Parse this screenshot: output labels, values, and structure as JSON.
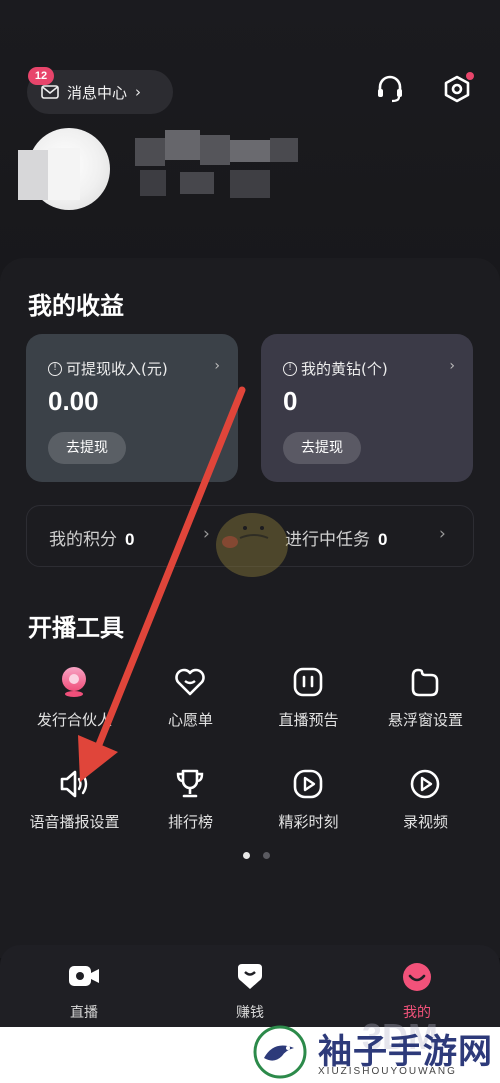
{
  "header": {
    "message_center_label": "消息中心",
    "message_badge": "12"
  },
  "earnings": {
    "title": "我的收益",
    "withdrawable": {
      "label": "可提现收入(元)",
      "value": "0.00",
      "button": "去提现"
    },
    "diamonds": {
      "label": "我的黄钻(个)",
      "value": "0",
      "button": "去提现"
    },
    "points_label": "我的积分",
    "points_value": "0",
    "tasks_label": "进行中任务",
    "tasks_value": "0"
  },
  "tools": {
    "title": "开播工具",
    "items": [
      {
        "label": "发行合伙人",
        "icon": "partner-icon"
      },
      {
        "label": "心愿单",
        "icon": "heart-icon"
      },
      {
        "label": "直播预告",
        "icon": "preview-icon"
      },
      {
        "label": "悬浮窗设置",
        "icon": "float-window-icon"
      },
      {
        "label": "语音播报设置",
        "icon": "voice-broadcast-icon"
      },
      {
        "label": "排行榜",
        "icon": "trophy-icon"
      },
      {
        "label": "精彩时刻",
        "icon": "play-circle-icon"
      },
      {
        "label": "录视频",
        "icon": "record-video-icon"
      }
    ]
  },
  "nav": {
    "items": [
      {
        "label": "直播",
        "icon": "live-camera-icon"
      },
      {
        "label": "赚钱",
        "icon": "earn-icon"
      },
      {
        "label": "我的",
        "icon": "profile-icon"
      }
    ],
    "active_color": "#f2527a"
  },
  "watermark": {
    "site_name": "袖子手游网",
    "site_pinyin": "XIUZISHOUYOUWANG"
  },
  "colors": {
    "badge": "#e8456b",
    "card_withdraw": "#3b4148",
    "card_diamond": "#3b3a47",
    "annotation_arrow": "#e0453a"
  }
}
